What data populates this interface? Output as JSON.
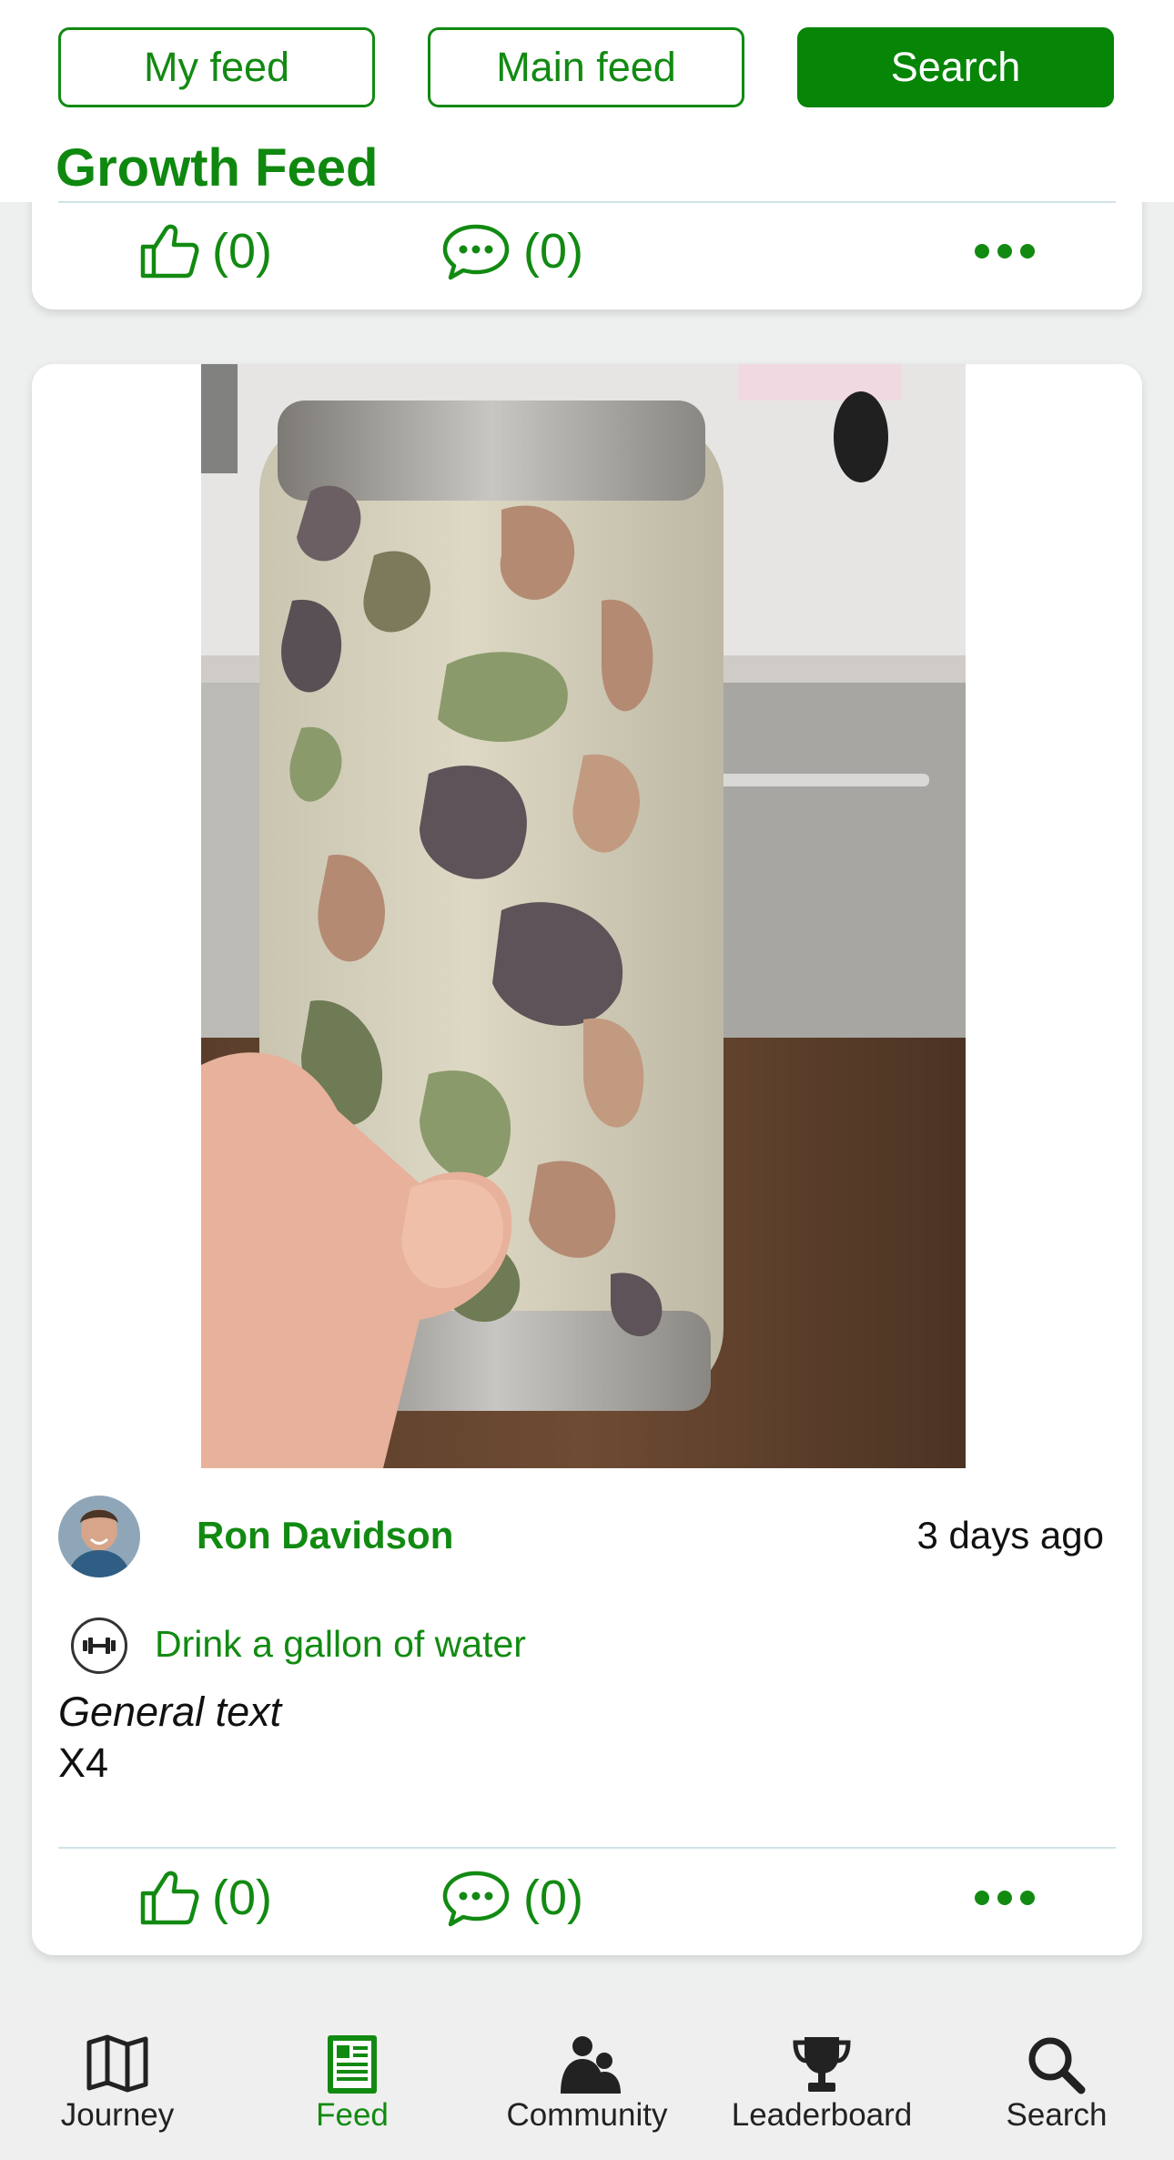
{
  "header": {
    "tabs": [
      {
        "label": "My feed",
        "active": false
      },
      {
        "label": "Main feed",
        "active": false
      },
      {
        "label": "Search",
        "active": true
      }
    ],
    "title": "Growth Feed"
  },
  "previous_post": {
    "likes": "(0)",
    "comments": "(0)"
  },
  "post": {
    "photo_alt": "camouflage tumbler",
    "author": "Ron Davidson",
    "time": "3 days ago",
    "habit": "Drink a gallon of water",
    "text_line_1": "General text",
    "text_line_2": "X4",
    "likes": "(0)",
    "comments": "(0)"
  },
  "nav": {
    "items": [
      {
        "label": "Journey",
        "icon": "map-icon",
        "active": false
      },
      {
        "label": "Feed",
        "icon": "feed-icon",
        "active": true
      },
      {
        "label": "Community",
        "icon": "community-icon",
        "active": false
      },
      {
        "label": "Leaderboard",
        "icon": "trophy-icon",
        "active": false
      },
      {
        "label": "Search",
        "icon": "search-icon",
        "active": false
      }
    ]
  },
  "colors": {
    "brand_green": "#128a12",
    "active_tab_green": "#068506",
    "divider": "#cfe3e6"
  }
}
